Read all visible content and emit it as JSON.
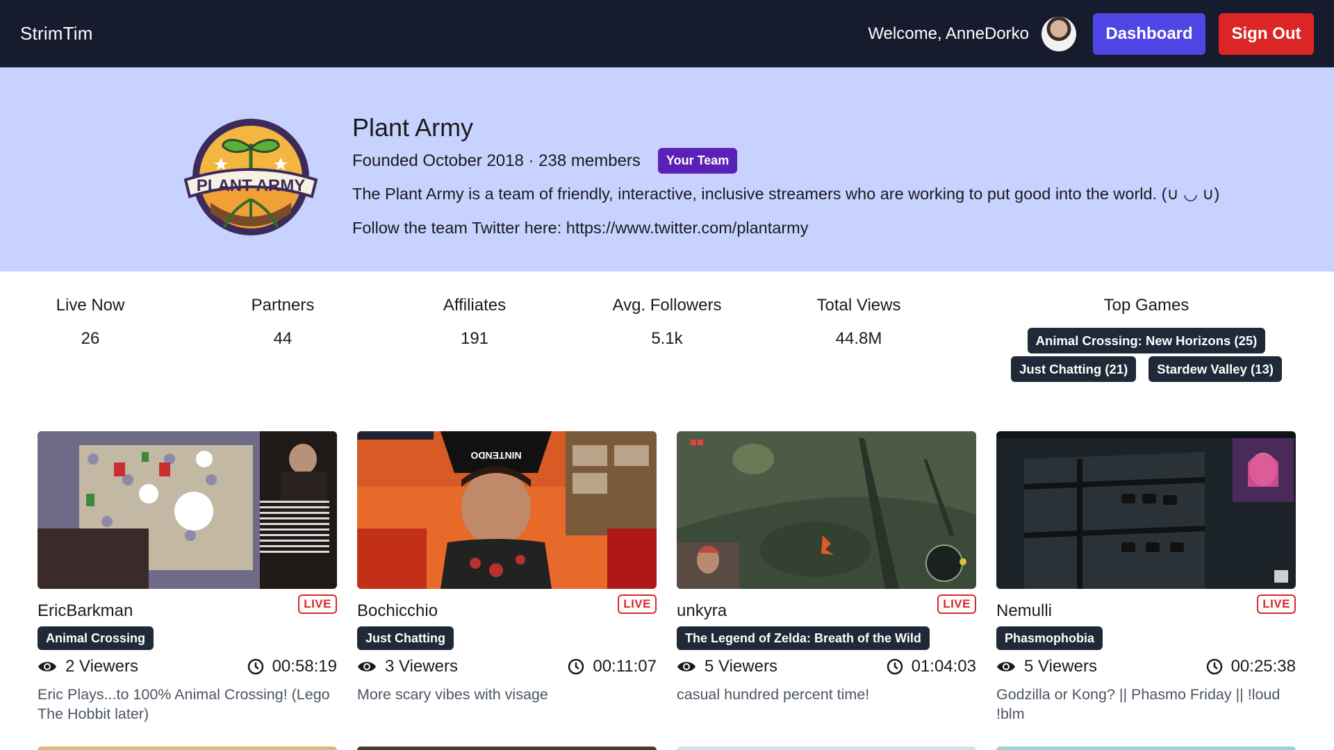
{
  "navbar": {
    "brand": "StrimTim",
    "welcome": "Welcome, AnneDorko",
    "dashboard_label": "Dashboard",
    "signout_label": "Sign Out"
  },
  "team": {
    "logo_text": "PLANT ARMY",
    "name": "Plant Army",
    "meta": "Founded October 2018 · 238 members",
    "badge": "Your Team",
    "description": "The Plant Army is a team of friendly, interactive, inclusive streamers who are working to put good into the world. (∪ ◡ ∪)",
    "twitter": "Follow the team Twitter here: https://www.twitter.com/plantarmy"
  },
  "stats": {
    "live_now": {
      "label": "Live Now",
      "value": "26"
    },
    "partners": {
      "label": "Partners",
      "value": "44"
    },
    "affiliates": {
      "label": "Affiliates",
      "value": "191"
    },
    "avg_followers": {
      "label": "Avg. Followers",
      "value": "5.1k"
    },
    "total_views": {
      "label": "Total Views",
      "value": "44.8M"
    },
    "top_games": {
      "label": "Top Games",
      "games": [
        "Animal Crossing: New Horizons (25)",
        "Just Chatting (21)",
        "Stardew Valley (13)"
      ]
    }
  },
  "streams": [
    {
      "streamer": "EricBarkman",
      "live": "LIVE",
      "game": "Animal Crossing",
      "viewers": "2 Viewers",
      "uptime": "00:58:19",
      "title": "Eric Plays...to 100% Animal Crossing! (Lego The Hobbit later)"
    },
    {
      "streamer": "Bochicchio",
      "live": "LIVE",
      "game": "Just Chatting",
      "viewers": "3 Viewers",
      "uptime": "00:11:07",
      "title": "More scary vibes with visage"
    },
    {
      "streamer": "unkyra",
      "live": "LIVE",
      "game": "The Legend of Zelda: Breath of the Wild",
      "viewers": "5 Viewers",
      "uptime": "01:04:03",
      "title": "casual hundred percent time!"
    },
    {
      "streamer": "Nemulli",
      "live": "LIVE",
      "game": "Phasmophobia",
      "viewers": "5 Viewers",
      "uptime": "00:25:38",
      "title": "Godzilla or Kong? || Phasmo Friday || !loud !blm"
    }
  ],
  "colors": {
    "navbar": "#161b2e",
    "header_bg": "#c7d2fe",
    "dashboard": "#4f46e5",
    "signout": "#dc2626",
    "badge": "#5b21b6",
    "tag": "#1f2937",
    "live": "#dc2626"
  },
  "icons": {
    "viewers": "eye-icon",
    "uptime": "clock-icon"
  }
}
